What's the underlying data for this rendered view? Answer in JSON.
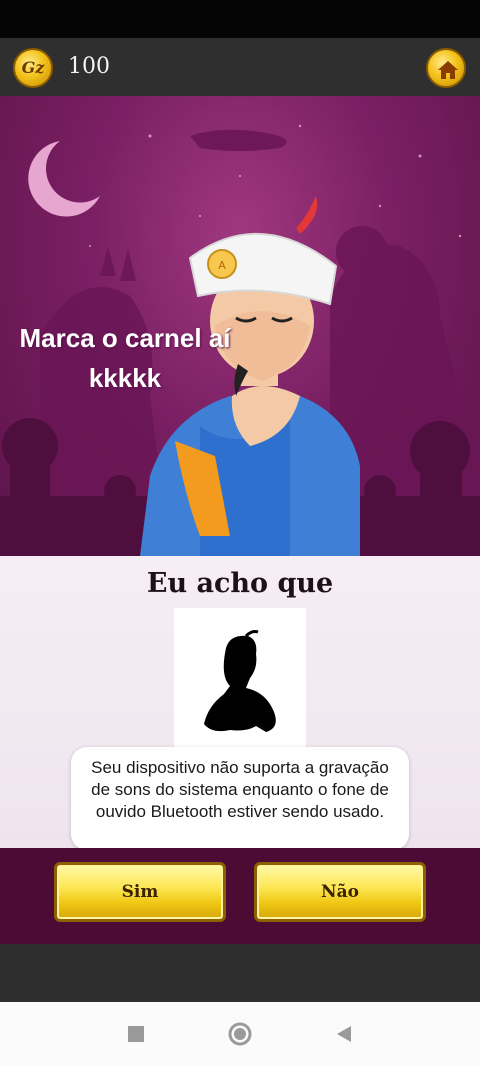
{
  "topbar": {
    "coin_label": "Gz",
    "coin_count": "100",
    "home_icon": "home-icon"
  },
  "scene": {
    "overlay_text_line1": "Marca o carnel aí",
    "overlay_text_line2": "kkkkk"
  },
  "guess": {
    "title": "Eu acho que"
  },
  "toast": {
    "message": "Seu dispositivo não suporta a gravação de sons do sistema enquanto o fone de ouvido Bluetooth estiver sendo usado."
  },
  "answers": {
    "yes_label": "Sim",
    "no_label": "Não"
  },
  "navbar": {
    "recent_icon": "recent-apps-icon",
    "home_icon": "home-circle-icon",
    "back_icon": "back-triangle-icon"
  },
  "colors": {
    "scene_purple": "#7a1f63",
    "answer_bar": "#4b0b35",
    "button_gold": "#fce858",
    "topbar": "#2f2f2f"
  }
}
